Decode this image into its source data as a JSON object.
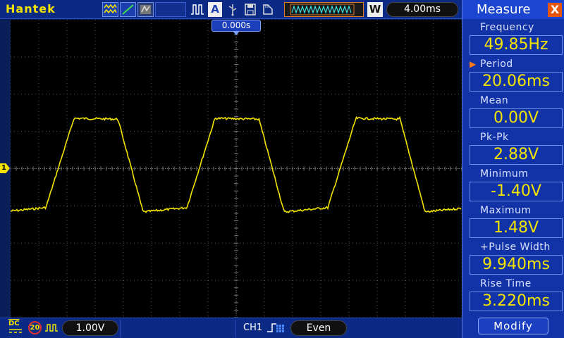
{
  "topbar": {
    "brand": "Hantek",
    "icons": [
      "waveform-mode-icon",
      "line-display-icon",
      "persist-icon",
      "run-icon",
      "acquire-icon",
      "save-icon",
      "disk-icon",
      "usb-icon"
    ],
    "acquire_label": "A",
    "window_badge": "W",
    "time_per_div": "4.00ms"
  },
  "screen": {
    "trigger_position": "0.000s",
    "channel_marker": "1",
    "trace_color": "#f2e400",
    "grid_color": "#555555"
  },
  "bottombar": {
    "coupling": "DC",
    "bw_limit": "20",
    "volts_per_div": "1.00V",
    "trigger_source": "CH1",
    "trigger_mode": "Even"
  },
  "measure": {
    "title": "Measure",
    "close_label": "X",
    "items": [
      {
        "label": "Frequency",
        "value": "49.85Hz"
      },
      {
        "label": "Period",
        "value": "20.06ms",
        "selected": true
      },
      {
        "label": "Mean",
        "value": "0.00V"
      },
      {
        "label": "Pk-Pk",
        "value": "2.88V"
      },
      {
        "label": "Minimum",
        "value": "-1.40V"
      },
      {
        "label": "Maximum",
        "value": "1.48V"
      },
      {
        "label": "+Pulse Width",
        "value": "9.940ms"
      },
      {
        "label": "Rise Time",
        "value": "3.220ms"
      }
    ],
    "modify_label": "Modify"
  }
}
